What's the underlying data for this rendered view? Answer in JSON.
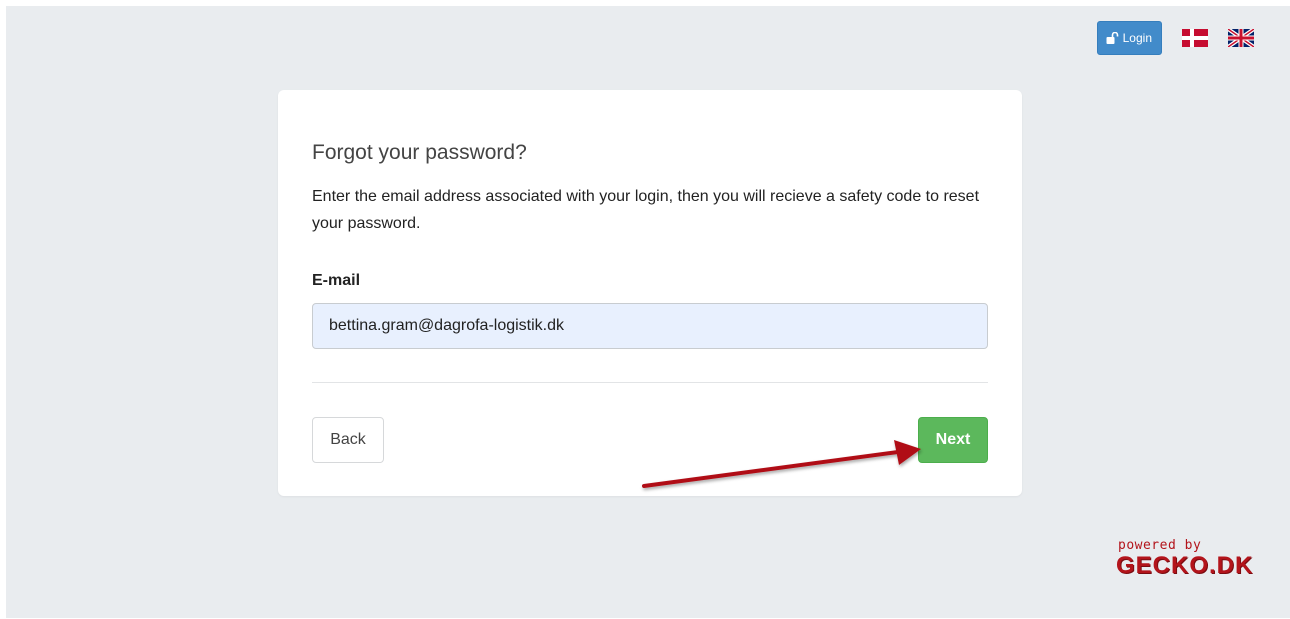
{
  "header": {
    "login_label": "Login",
    "lock_icon": "unlock-icon",
    "flags": [
      {
        "name": "danish-flag-icon",
        "colors": [
          "#c60c30",
          "#ffffff"
        ]
      },
      {
        "name": "uk-flag-icon",
        "colors": [
          "#012169",
          "#ffffff",
          "#c8102e"
        ]
      }
    ],
    "login_color": "#428bca"
  },
  "form": {
    "title": "Forgot your password?",
    "description": "Enter the email address associated with your login, then you will recieve a safety code to reset your password.",
    "email_label": "E-mail",
    "email_value": "bettina.gram@dagrofa-logistik.dk",
    "back_label": "Back",
    "next_label": "Next",
    "next_color": "#5cb85c"
  },
  "annotation": {
    "arrow_icon": "red-arrow-annotation",
    "arrow_color": "#b01018"
  },
  "footer": {
    "powered_by": "powered by",
    "brand": "GECKO.DK",
    "brand_color": "#b3141b"
  }
}
